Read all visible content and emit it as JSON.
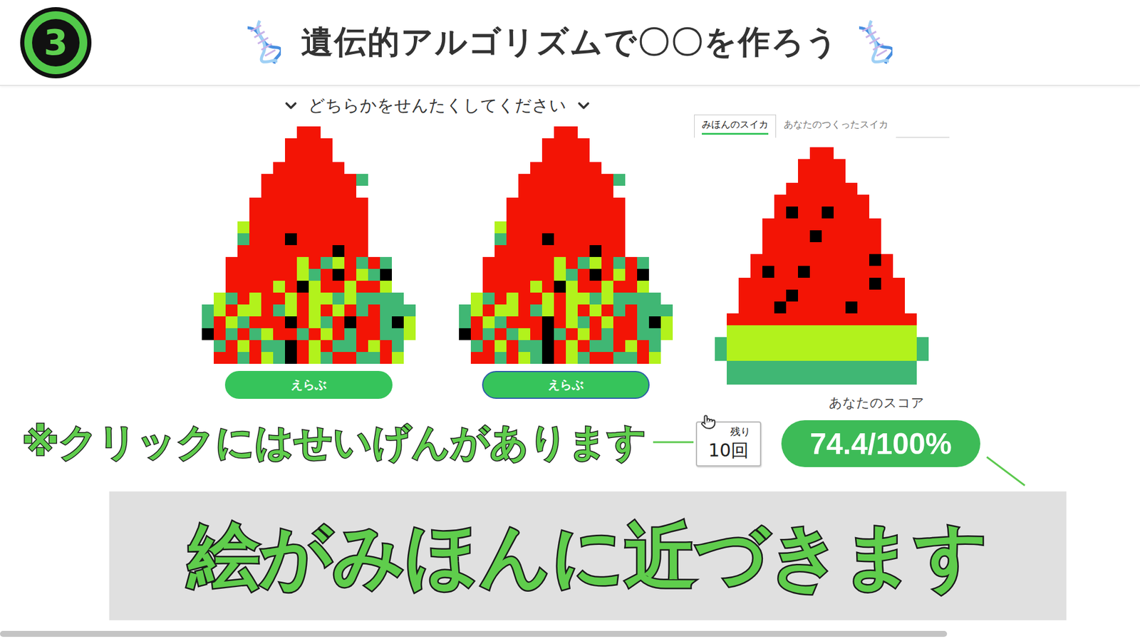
{
  "page": {
    "badge": "3",
    "title": "遺伝的アルゴリズムで〇〇を作ろう"
  },
  "instruction": "どちらかをせんたくしてください",
  "candidates": [
    {
      "button": "えらぶ",
      "focused": false,
      "pixels": [
        "........RR........",
        ".......RRRR.......",
        ".......RRRR.......",
        "......RRRRRR......",
        ".....RRRRRRRRG....",
        ".....RRRRRRRR.....",
        "....RRRRRRRRRR....",
        "....RRRRRRRRRR....",
        "...LRRRRRRRRRR....",
        "...GRRRKRRRRRR....",
        "...RRRRRRRRKRR....",
        "..RRRRRRLRGLRGRG..",
        "..RRRRRRLGRKRLGK..",
        "..RRRRLRKLRRLRRL..",
        ".LGRLRRLRLLGLGGGG.",
        "GLRLLRGLRLRLRGRGGG",
        "GRLGRRRKRLGRKRRGKL",
        "KRGRGLRRGRLRGRRGGL",
        ".GRLRGGKRLRGGRLRG.",
        ".RRGRLGKRLGRRGGRL."
      ]
    },
    {
      "button": "えらぶ",
      "focused": true,
      "pixels": [
        "........RR........",
        ".......RRRR.......",
        ".......RRRR.......",
        "......RRRRRR......",
        ".....RRRRRRRRG....",
        ".....RRRRRRRR.....",
        "....RRRRRRRRRR....",
        "....RRRRRRRRRR....",
        "...LRRRRRRRRRR....",
        "...GRRRKRRRRRR....",
        "...RRRRRRRRKRR....",
        "..RRRRRRLRGLRGRG..",
        "..RRRRRRLGRKRLRK..",
        "..RRRRLRKLRRLRRL..",
        ".LGRLRRLRLLGLGGGG.",
        "GLRLLRGLRLRLRGRGGG",
        "GRLGRRRKRLGRLRRGKL",
        "KRGRGLRKGRLRGRRGGL",
        ".GRLRGGKRLRGGRLRG.",
        ".RRGRLGKRLGRRGGRL."
      ]
    }
  ],
  "tabs": [
    {
      "label": "みほんのスイカ",
      "selected": true
    },
    {
      "label": "あなたのつくったスイカ",
      "selected": false
    }
  ],
  "sample": {
    "pixels": [
      "........RR........",
      ".......RRRR.......",
      ".......RRRR.......",
      "......RRRRRR......",
      ".....RRRRRRRR.....",
      ".....RKRRKRRR.....",
      "....RRRRRRRRRR....",
      "....RRRRKRRRRR....",
      "....RRRRRRRRRR....",
      "...RRRRRRRRRRKR...",
      "...RKRRKRRRRRRR...",
      "..RRRRRRRRRRRKRR..",
      "..RRRRKRRRRRRRRR..",
      "..RRRKRRRRRKRRRR..",
      ".RRRRRRRRRRRRRRRR.",
      ".LLLLLLLLLLLLLLLL.",
      "GLLLLLLLLLLLLLLLLG",
      "GLLLLLLLLLLLLLLLLG",
      ".GGGGGGGGGGGGGGGG.",
      ".GGGGGGGGGGGGGGGG."
    ]
  },
  "score": {
    "label": "あなたのスコア",
    "value": "74.4/100%"
  },
  "remaining": {
    "label": "残り",
    "count": "10回"
  },
  "notes": {
    "click_limit": "※クリックにはせいげんがあります",
    "caption": "絵がみほんに近づきます"
  }
}
